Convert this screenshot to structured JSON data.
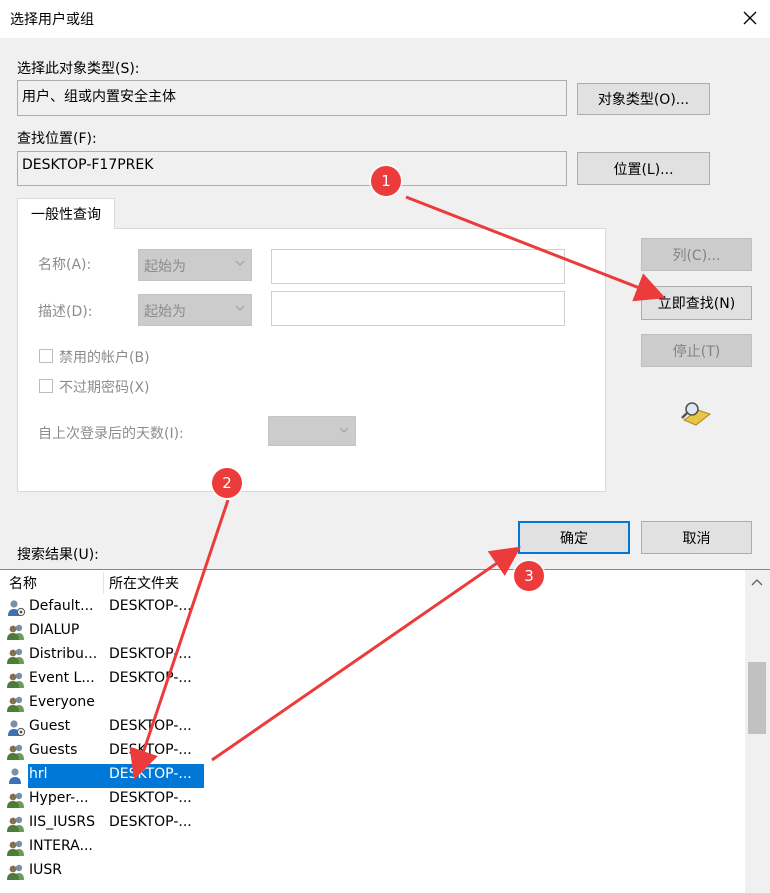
{
  "window": {
    "title": "选择用户或组"
  },
  "object_type": {
    "label": "选择此对象类型(S):",
    "value": "用户、组或内置安全主体",
    "button": "对象类型(O)..."
  },
  "location": {
    "label": "查找位置(F):",
    "value": "DESKTOP-F17PREK",
    "button": "位置(L)..."
  },
  "query": {
    "tab": "一般性查询",
    "name_label": "名称(A):",
    "name_mode": "起始为",
    "desc_label": "描述(D):",
    "desc_mode": "起始为",
    "disabled_accounts": "禁用的帐户(B)",
    "non_expiring": "不过期密码(X)",
    "days_label": "自上次登录后的天数(I):"
  },
  "buttons": {
    "columns": "列(C)...",
    "find_now": "立即查找(N)",
    "stop": "停止(T)",
    "ok": "确定",
    "cancel": "取消"
  },
  "results": {
    "label": "搜索结果(U):",
    "columns": [
      "名称",
      "所在文件夹"
    ],
    "rows": [
      {
        "name": "Default...",
        "folder": "DESKTOP-...",
        "icon": "user-system-icon"
      },
      {
        "name": "DIALUP",
        "folder": "",
        "icon": "group-icon"
      },
      {
        "name": "Distribu...",
        "folder": "DESKTOP-...",
        "icon": "group-icon"
      },
      {
        "name": "Event L...",
        "folder": "DESKTOP-...",
        "icon": "group-icon"
      },
      {
        "name": "Everyone",
        "folder": "",
        "icon": "group-icon"
      },
      {
        "name": "Guest",
        "folder": "DESKTOP-...",
        "icon": "user-system-icon"
      },
      {
        "name": "Guests",
        "folder": "DESKTOP-...",
        "icon": "group-icon"
      },
      {
        "name": "hrl",
        "folder": "DESKTOP-...",
        "icon": "user-icon",
        "selected": true
      },
      {
        "name": "Hyper-...",
        "folder": "DESKTOP-...",
        "icon": "group-icon"
      },
      {
        "name": "IIS_IUSRS",
        "folder": "DESKTOP-...",
        "icon": "group-icon"
      },
      {
        "name": "INTERA...",
        "folder": "",
        "icon": "group-icon"
      },
      {
        "name": "IUSR",
        "folder": "",
        "icon": "group-icon"
      }
    ]
  },
  "annotations": [
    "1",
    "2",
    "3"
  ],
  "colors": {
    "accent": "#0078d7",
    "annotation": "#ec3b3b"
  }
}
